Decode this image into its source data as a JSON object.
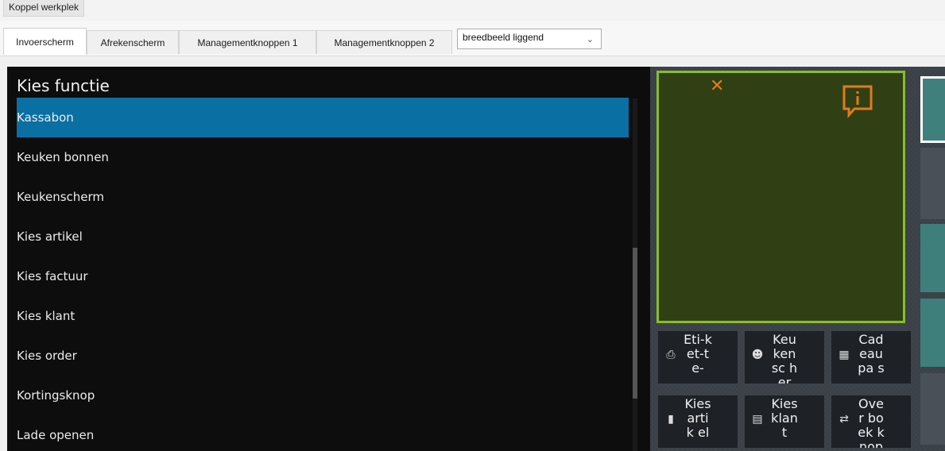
{
  "window": {
    "title": "Koppel werkplek"
  },
  "tabs": [
    {
      "label": "Invoerscherm",
      "active": true
    },
    {
      "label": "Afrekenscherm",
      "active": false
    },
    {
      "label": "Managementknoppen 1",
      "active": false
    },
    {
      "label": "Managementknoppen 2",
      "active": false
    }
  ],
  "layout_select": {
    "value": "breedbeeld liggend"
  },
  "function_panel": {
    "title": "Kies functie",
    "items": [
      "Kassabon",
      "Keuken bonnen",
      "Keukenscherm",
      "Kies artikel",
      "Kies factuur",
      "Kies klant",
      "Kies order",
      "Kortingsknop",
      "Lade openen"
    ],
    "selected_index": 0
  },
  "preview": {
    "buttons": [
      {
        "label": "Eti-ket-te-",
        "icon": "printer-icon"
      },
      {
        "label": "Keukensc her",
        "icon": "chef-hat-icon"
      },
      {
        "label": "Cadeaupa s",
        "icon": "gift-card-icon"
      },
      {
        "label": "Kies artik el",
        "icon": "barcode-icon"
      },
      {
        "label": "Kies klant",
        "icon": "contact-card-icon"
      },
      {
        "label": "Over boek knop",
        "icon": "transfer-icon"
      }
    ]
  },
  "colors": {
    "selected_item": "#0a6fa3",
    "screen_border": "#86bf28",
    "screen_fill": "#313f14",
    "accent_orange": "#e07c1a",
    "teal_tile": "#3e7f7c"
  }
}
